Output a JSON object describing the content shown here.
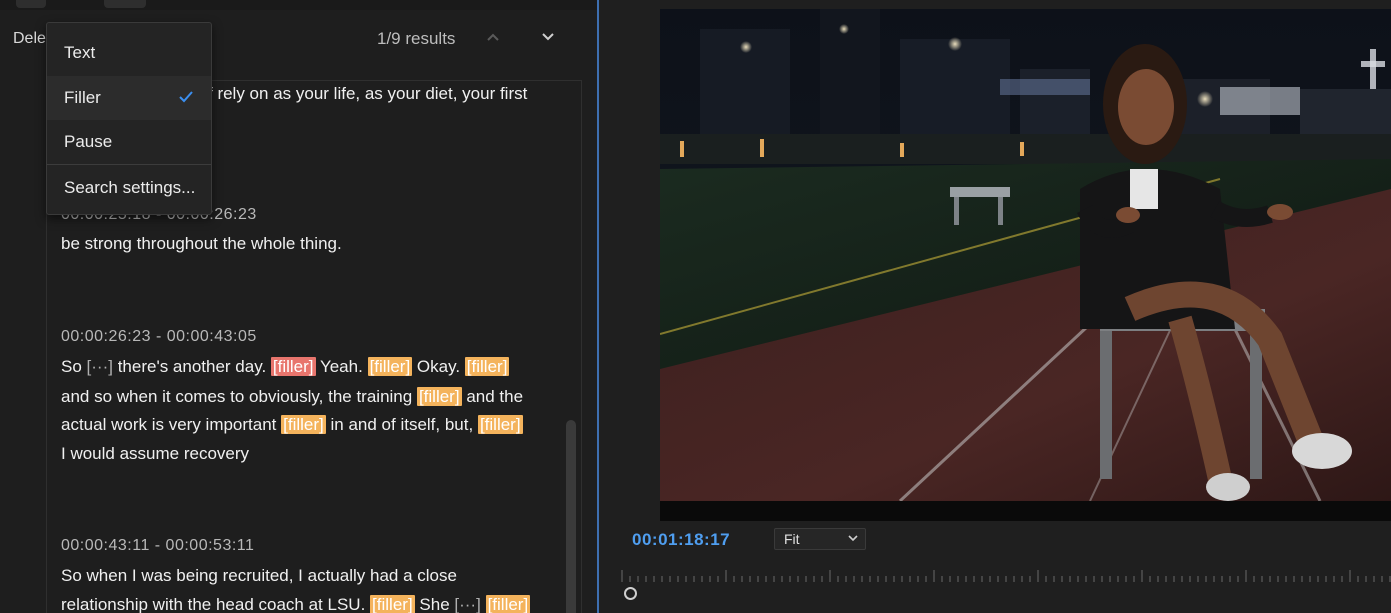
{
  "search": {
    "delete_label": "Dele",
    "results": "1/9 results"
  },
  "menu": {
    "items": [
      {
        "label": "Text",
        "checked": false
      },
      {
        "label": "Filler",
        "checked": true
      },
      {
        "label": "Pause",
        "checked": false
      }
    ],
    "settings_label": "Search settings..."
  },
  "transcript": {
    "line_partial": "f rely on as your life, as your diet, your first",
    "seg1": {
      "timestamp": "00:00:25:18 - 00:00:26:23",
      "text": "be strong throughout the whole thing."
    },
    "seg2": {
      "timestamp": "00:00:26:23 - 00:00:43:05",
      "l1_a": "So",
      "pause_mark": "[···]",
      "l1_b": "there's another day.",
      "l1_c": "Yeah.",
      "l1_d": "Okay.",
      "l2_a": "and so when it comes to obviously, the training",
      "l2_b": "and the",
      "l3_a": "actual work is very important",
      "l3_b": "in and of itself, but,",
      "l4": "I would assume recovery"
    },
    "seg3": {
      "timestamp": "00:00:43:11 - 00:00:53:11",
      "l1": "So when I was being recruited, I actually had a close",
      "l2_a": "relationship with the head coach at LSU.",
      "l2_b": "She"
    },
    "filler_tag": "[filler]"
  },
  "monitor": {
    "timecode": "00:01:18:17",
    "zoom": "Fit"
  },
  "colors": {
    "accent_blue": "#4f9ef0",
    "filler_highlight": "#f4b35c",
    "filler_active": "#e8756d",
    "check_blue": "#3b8ff0"
  }
}
